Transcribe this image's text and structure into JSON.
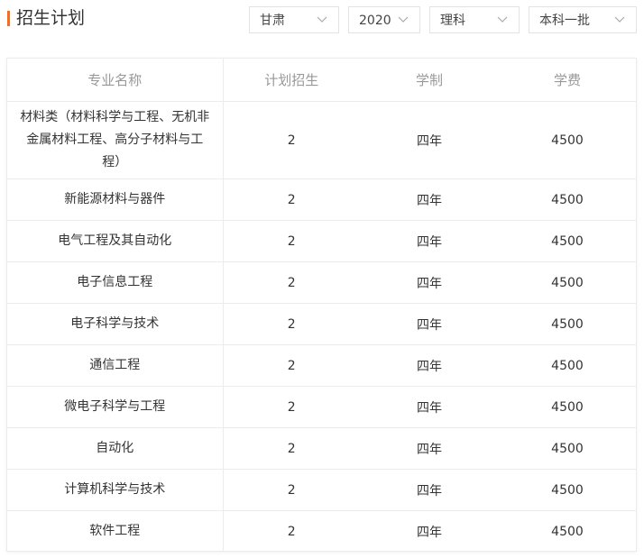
{
  "header": {
    "title": "招生计划"
  },
  "filters": {
    "province": "甘肃",
    "year": "2020",
    "category": "理科",
    "batch": "本科一批"
  },
  "table": {
    "columns": [
      "专业名称",
      "计划招生",
      "学制",
      "学费"
    ],
    "rows": [
      [
        "材料类（材料科学与工程、无机非金属材料工程、高分子材料与工程）",
        "2",
        "四年",
        "4500"
      ],
      [
        "新能源材料与器件",
        "2",
        "四年",
        "4500"
      ],
      [
        "电气工程及其自动化",
        "2",
        "四年",
        "4500"
      ],
      [
        "电子信息工程",
        "2",
        "四年",
        "4500"
      ],
      [
        "电子科学与技术",
        "2",
        "四年",
        "4500"
      ],
      [
        "通信工程",
        "2",
        "四年",
        "4500"
      ],
      [
        "微电子科学与工程",
        "2",
        "四年",
        "4500"
      ],
      [
        "自动化",
        "2",
        "四年",
        "4500"
      ],
      [
        "计算机科学与技术",
        "2",
        "四年",
        "4500"
      ],
      [
        "软件工程",
        "2",
        "四年",
        "4500"
      ]
    ]
  },
  "colors": {
    "accent": "#ff6a14",
    "border": "#ececec",
    "header_text": "#999999",
    "body_text": "#333333"
  },
  "icons": {
    "dropdown": "chevron-down-icon"
  }
}
